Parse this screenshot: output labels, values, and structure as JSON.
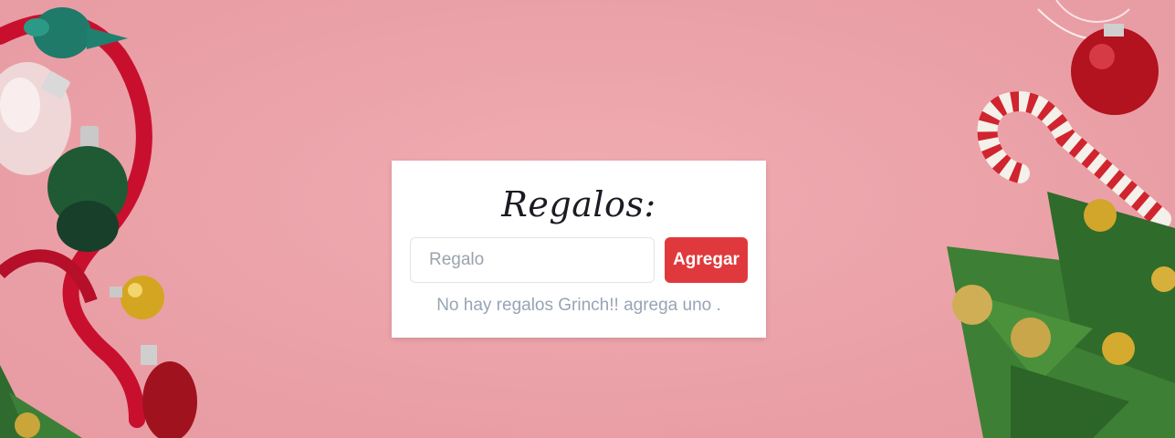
{
  "card": {
    "title": "Regalos:",
    "input": {
      "placeholder": "Regalo",
      "value": ""
    },
    "add_button_label": "Agregar",
    "empty_message": "No hay regalos Grinch!! agrega uno ."
  },
  "colors": {
    "background": "#eda4ab",
    "button": "#e0393d",
    "empty_text": "#97a4b5"
  },
  "decorations": {
    "left": [
      "ornament-icon",
      "ribbon-icon",
      "heart-ornament-icon",
      "pinecone-ornament-icon",
      "gold-ball-icon"
    ],
    "right": [
      "red-ball-ornament-icon",
      "candy-cane-icon",
      "pine-branch-icon",
      "gold-ball-icon"
    ]
  }
}
